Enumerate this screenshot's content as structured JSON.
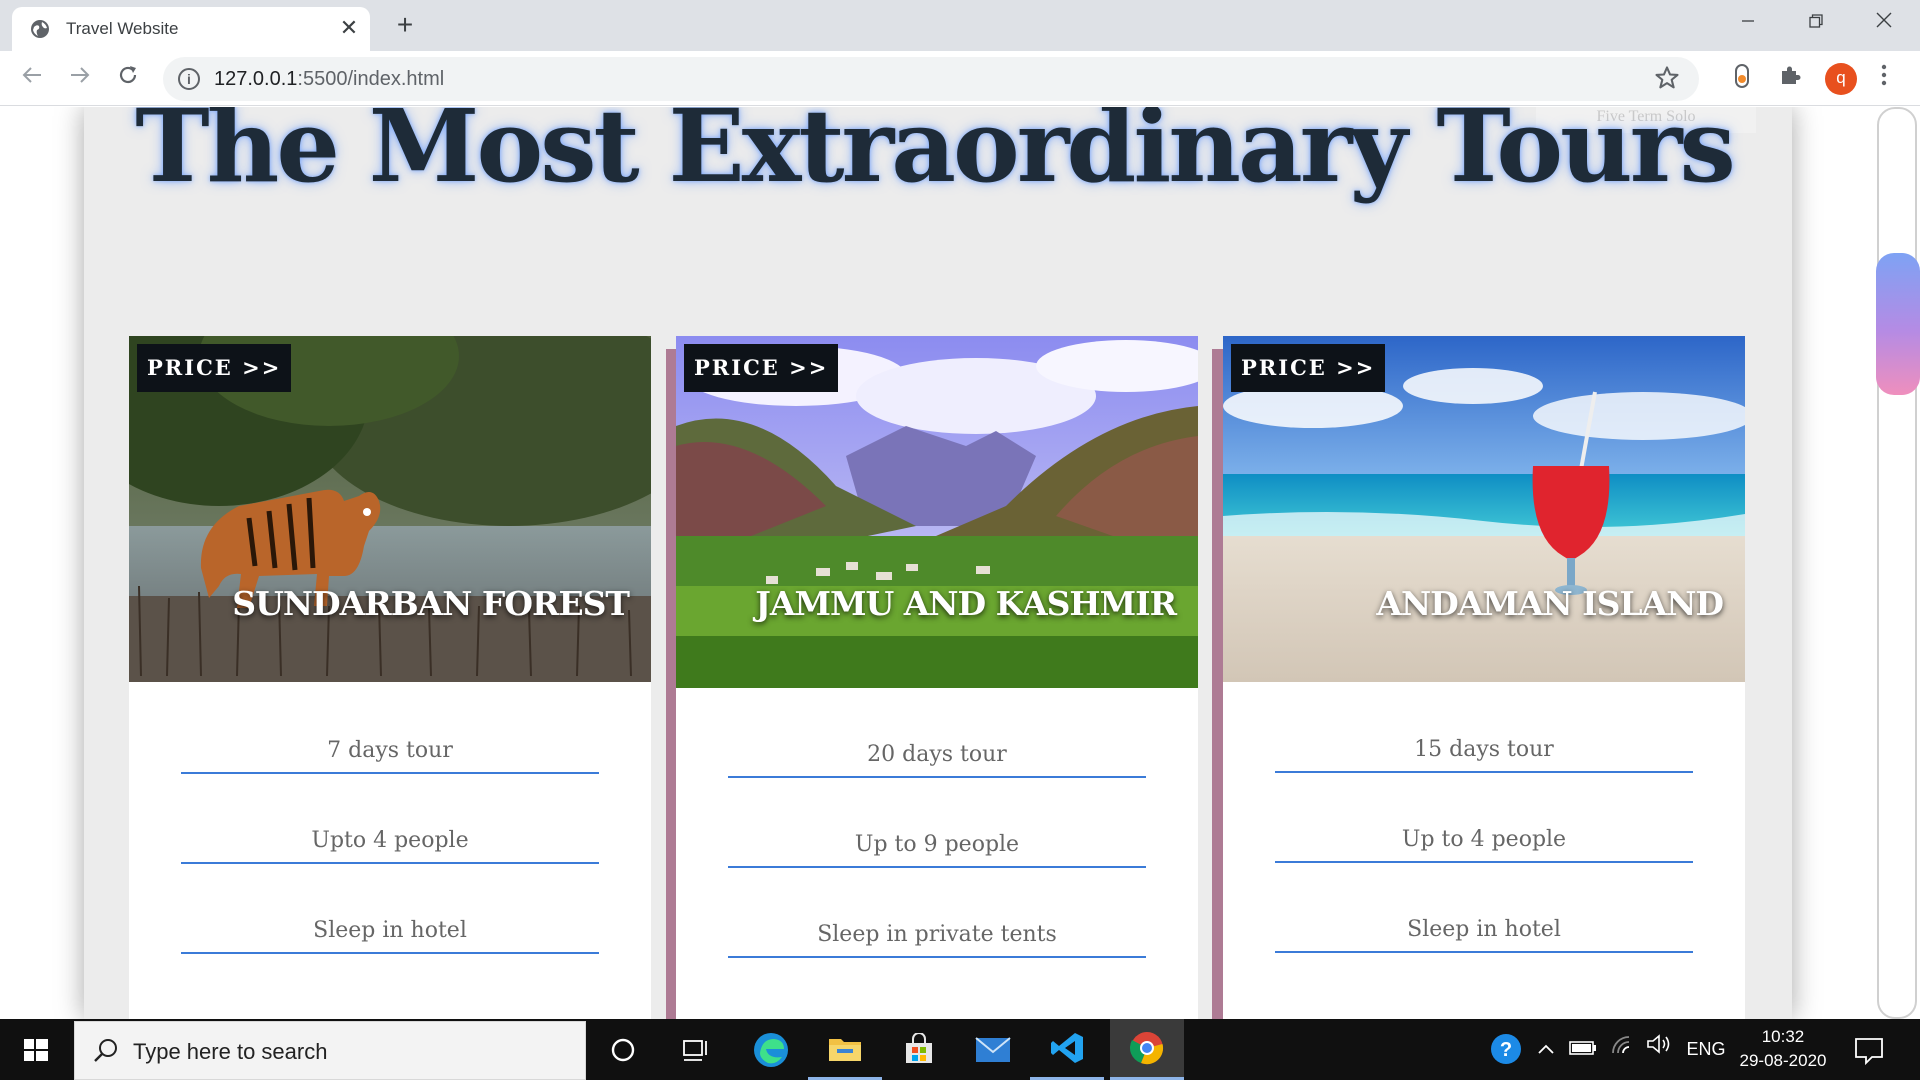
{
  "browser": {
    "tab_title": "Travel Website",
    "tab_close": "✕",
    "new_tab": "+",
    "url_host": "127.0.0.1",
    "url_rest": ":5500/index.html",
    "avatar_letter": "q"
  },
  "page": {
    "faded_link": "Five Term Solo",
    "heading": "The Most Extraordinary Tours",
    "cards": [
      {
        "price_label": "PRICE >>",
        "title": "SUNDARBAN FOREST",
        "details": [
          "7 days tour",
          "Upto 4 people",
          "Sleep in hotel"
        ],
        "image": "tiger-forest-image"
      },
      {
        "price_label": "PRICE >>",
        "title": "JAMMU AND KASHMIR",
        "details": [
          "20 days tour",
          "Up to 9 people",
          "Sleep in private tents"
        ],
        "image": "mountain-valley-image"
      },
      {
        "price_label": "PRICE >>",
        "title": "ANDAMAN ISLAND",
        "details": [
          "15 days tour",
          "Up to 4 people",
          "Sleep in hotel"
        ],
        "image": "beach-drink-image"
      }
    ]
  },
  "taskbar": {
    "search_placeholder": "Type here to search",
    "language": "ENG",
    "time": "10:32",
    "date": "29-08-2020"
  },
  "colors": {
    "card_back": "#ae7b94",
    "divider": "#3b7bd8",
    "heading": "#1e2b38"
  }
}
